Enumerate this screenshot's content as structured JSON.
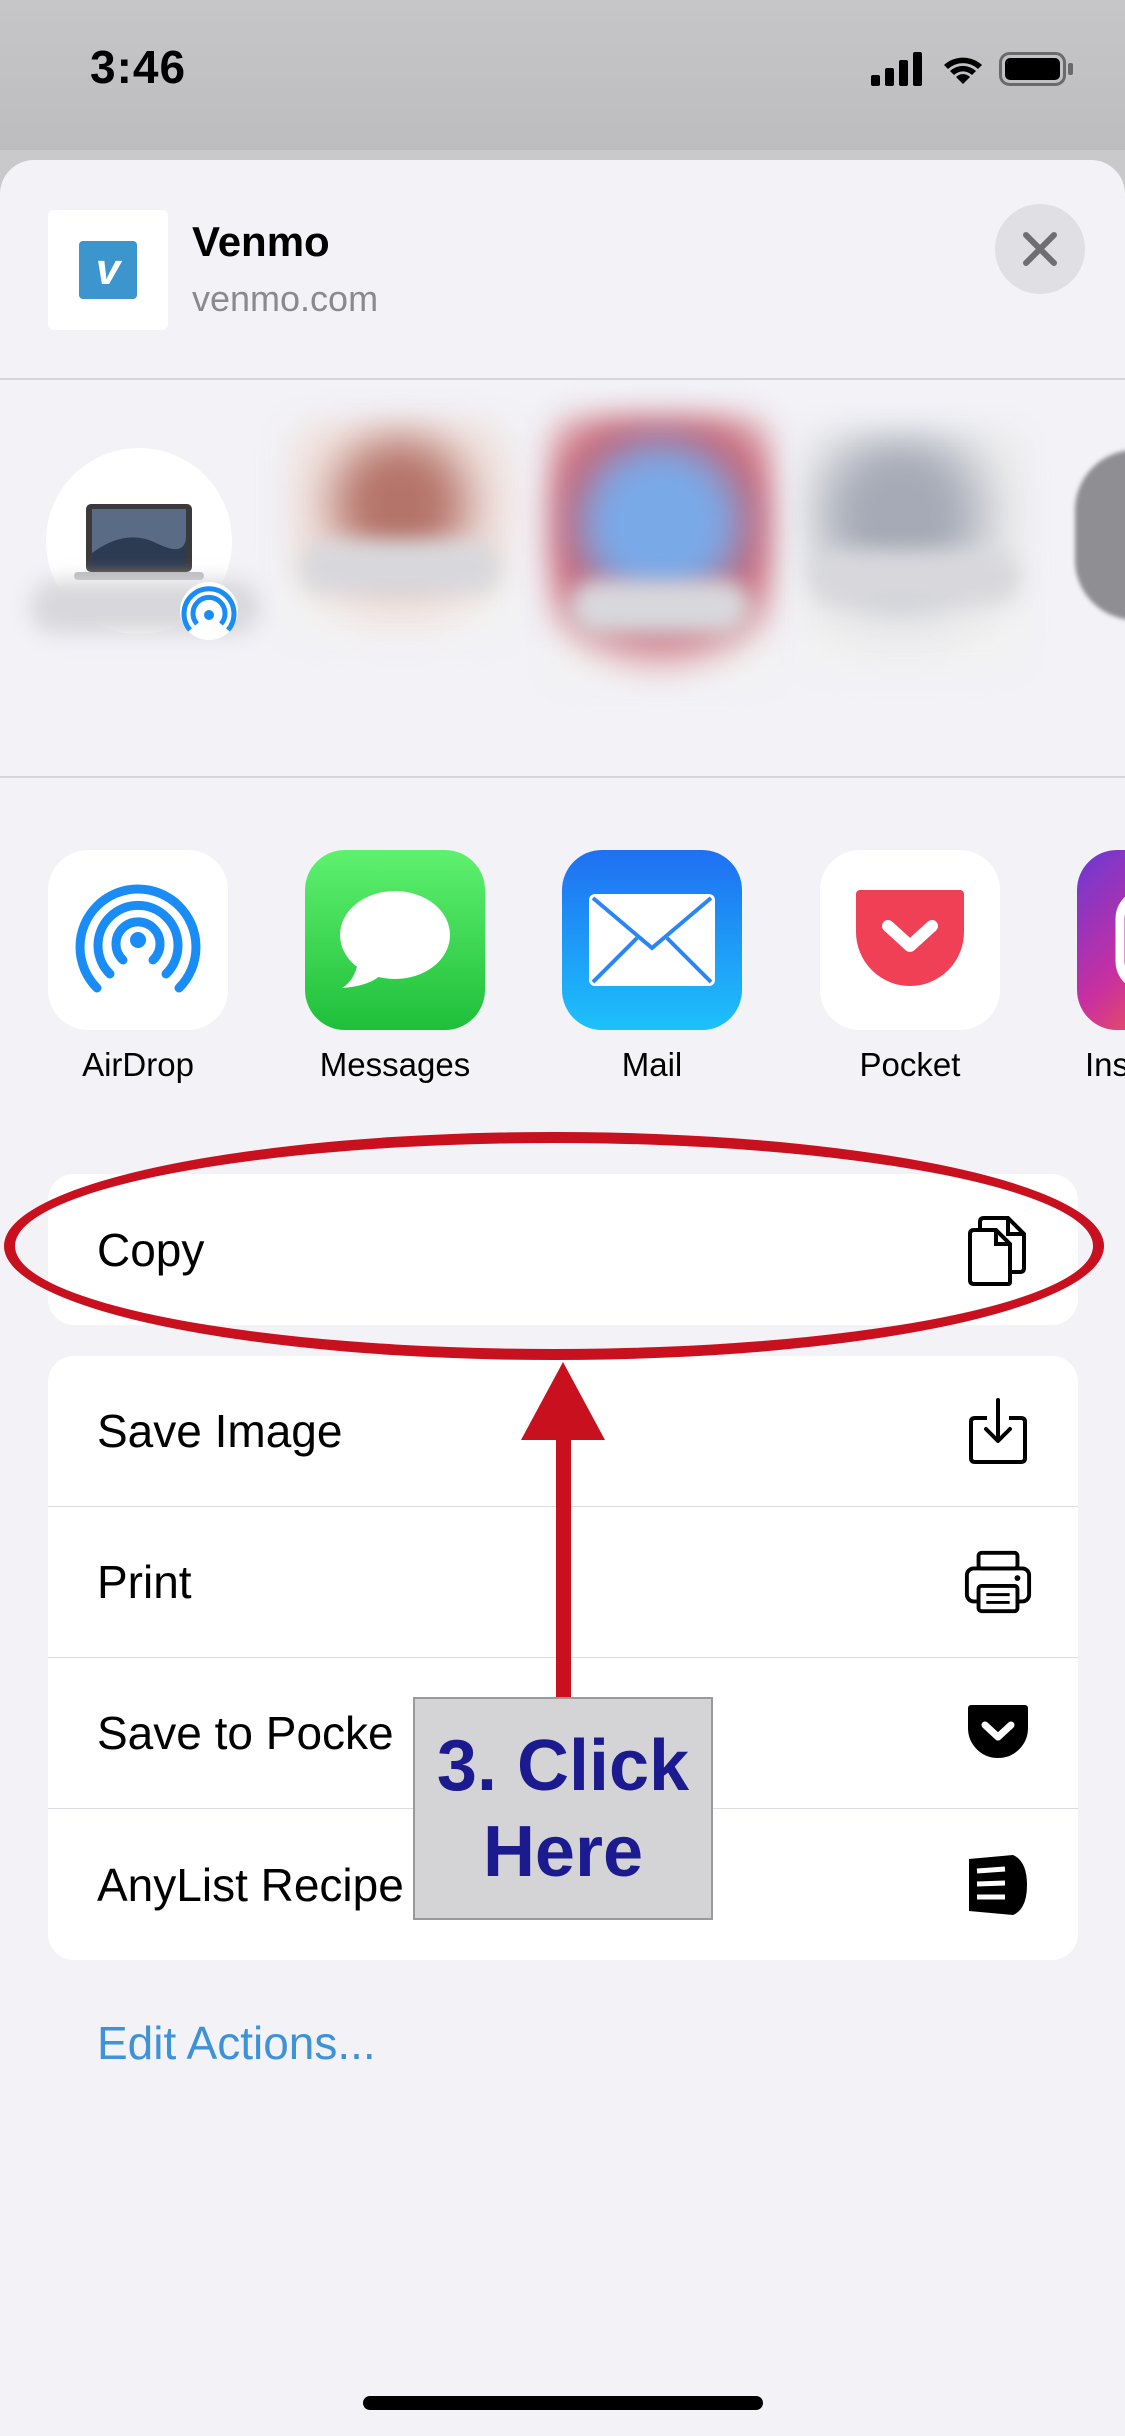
{
  "status_bar": {
    "time": "3:46"
  },
  "share_header": {
    "title": "Venmo",
    "subtitle": "venmo.com",
    "logo_letter": "v"
  },
  "apps": [
    {
      "label": "AirDrop",
      "icon": "airdrop-icon"
    },
    {
      "label": "Messages",
      "icon": "messages-icon"
    },
    {
      "label": "Mail",
      "icon": "mail-icon"
    },
    {
      "label": "Pocket",
      "icon": "pocket-icon"
    },
    {
      "label": "Ins",
      "icon": "instagram-icon"
    }
  ],
  "actions": {
    "copy": {
      "label": "Copy",
      "icon": "copy-icon"
    },
    "save_image": {
      "label": "Save Image",
      "icon": "save-image-icon"
    },
    "print": {
      "label": "Print",
      "icon": "print-icon"
    },
    "save_to_pocket": {
      "label": "Save to Pocke",
      "icon": "pocket-icon"
    },
    "anylist_recipe": {
      "label": "AnyList Recipe",
      "icon": "anylist-icon"
    }
  },
  "edit_actions_label": "Edit Actions...",
  "annotation": {
    "text": "3. Click\nHere",
    "color": "#c8101e",
    "text_color": "#1b1b8f"
  },
  "colors": {
    "link": "#3e93d8",
    "venmo": "#3d95ce",
    "messages": "#34c759",
    "mail": "#1a8cf6",
    "pocket": "#ef4056"
  }
}
